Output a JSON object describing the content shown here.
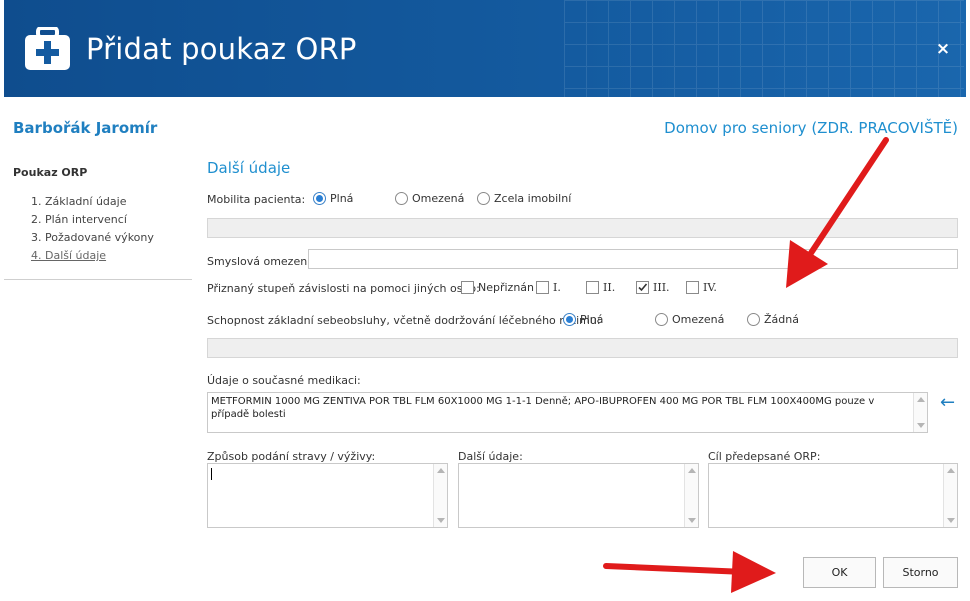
{
  "dialog": {
    "title": "Přidat poukaz ORP",
    "close_label": "×"
  },
  "patient_name": "Barbořák Jaromír",
  "facility": "Domov pro seniory (ZDR. PRACOVIŠTĚ)",
  "sidebar": {
    "title": "Poukaz ORP",
    "items": [
      {
        "label": "1. Základní údaje",
        "active": false
      },
      {
        "label": "2. Plán intervencí",
        "active": false
      },
      {
        "label": "3. Požadované výkony",
        "active": false
      },
      {
        "label": "4. Další údaje",
        "active": true
      }
    ]
  },
  "section_title": "Další údaje",
  "mobility": {
    "label": "Mobilita pacienta:",
    "options": [
      "Plná",
      "Omezená",
      "Zcela imobilní"
    ],
    "selected": "Plná"
  },
  "sensory": {
    "label": "Smyslová omezení:",
    "value": ""
  },
  "dependency": {
    "label": "Přiznaný stupeň závislosti na pomoci jiných osob:",
    "options": [
      "Nepřiznán",
      "I.",
      "II.",
      "III.",
      "IV."
    ],
    "checked": "III."
  },
  "selfcare": {
    "label": "Schopnost základní sebeobsluhy, včetně dodržování léčebného režimu:",
    "options": [
      "Plná",
      "Omezená",
      "Žádná"
    ],
    "selected": "Plná"
  },
  "medication": {
    "label": "Údaje o současné medikaci:",
    "value": "METFORMIN 1000 MG ZENTIVA POR TBL FLM 60X1000 MG 1-1-1 Denně; APO-IBUPROFEN 400 MG POR TBL FLM 100X400MG pouze v případě bolesti"
  },
  "nutrition": {
    "label": "Způsob podání stravy / výživy:",
    "value": ""
  },
  "other": {
    "label": "Další údaje:",
    "value": ""
  },
  "goal": {
    "label": "Cíl předepsané ORP:",
    "value": ""
  },
  "buttons": {
    "ok": "OK",
    "cancel": "Storno"
  },
  "icons": {
    "header": "first-aid-kit-icon",
    "close": "close-icon",
    "back": "arrow-left-icon"
  },
  "colors": {
    "header": "#145ba0",
    "accent": "#1f8fcf",
    "annotation": "#e01b1b"
  }
}
